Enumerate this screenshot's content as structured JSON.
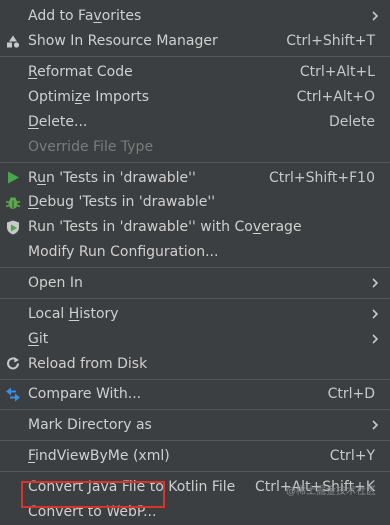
{
  "menu": [
    {
      "type": "item",
      "label": "Add to Favorites",
      "mnemonic": "v",
      "submenu": true
    },
    {
      "type": "item",
      "label": "Show In Resource Manager",
      "shortcut": "Ctrl+Shift+T",
      "icon": "resource-manager-icon"
    },
    {
      "type": "separator"
    },
    {
      "type": "item",
      "label": "Reformat Code",
      "mnemonic": "R",
      "shortcut": "Ctrl+Alt+L"
    },
    {
      "type": "item",
      "label": "Optimize Imports",
      "mnemonic": "z",
      "shortcut": "Ctrl+Alt+O"
    },
    {
      "type": "item",
      "label": "Delete...",
      "mnemonic": "D",
      "shortcut": "Delete"
    },
    {
      "type": "item",
      "label": "Override File Type",
      "disabled": true
    },
    {
      "type": "separator"
    },
    {
      "type": "item",
      "label": "Run 'Tests in 'drawable''",
      "mnemonic": "u",
      "shortcut": "Ctrl+Shift+F10",
      "icon": "run-icon"
    },
    {
      "type": "item",
      "label": "Debug 'Tests in 'drawable''",
      "mnemonic": "D",
      "icon": "debug-icon"
    },
    {
      "type": "item",
      "label": "Run 'Tests in 'drawable'' with Coverage",
      "mnemonic": "v",
      "icon": "coverage-icon"
    },
    {
      "type": "item",
      "label": "Modify Run Configuration..."
    },
    {
      "type": "separator"
    },
    {
      "type": "item",
      "label": "Open In",
      "submenu": true
    },
    {
      "type": "separator"
    },
    {
      "type": "item",
      "label": "Local History",
      "mnemonic": "H",
      "submenu": true
    },
    {
      "type": "item",
      "label": "Git",
      "mnemonic": "G",
      "submenu": true
    },
    {
      "type": "item",
      "label": "Reload from Disk",
      "icon": "reload-icon"
    },
    {
      "type": "separator"
    },
    {
      "type": "item",
      "label": "Compare With...",
      "shortcut": "Ctrl+D",
      "icon": "compare-icon"
    },
    {
      "type": "separator"
    },
    {
      "type": "item",
      "label": "Mark Directory as",
      "submenu": true
    },
    {
      "type": "separator"
    },
    {
      "type": "item",
      "label": "FindViewByMe (xml)",
      "mnemonic": "F",
      "shortcut": "Ctrl+Y"
    },
    {
      "type": "separator"
    },
    {
      "type": "item",
      "label": "Convert Java File to Kotlin File",
      "shortcut": "Ctrl+Alt+Shift+K"
    },
    {
      "type": "item",
      "label": "Convert to WebP...",
      "highlighted": true
    }
  ],
  "watermark": "@稀土掘金技术社区",
  "colors": {
    "background": "#3c3f41",
    "run": "#4aa54d",
    "debug": "#5da84d",
    "compare": "#3a8ee6",
    "highlight": "#d9342b"
  }
}
